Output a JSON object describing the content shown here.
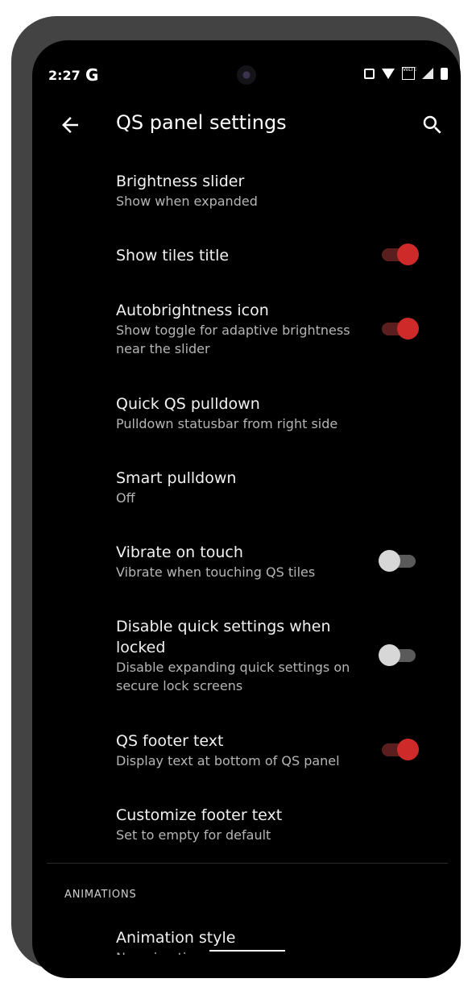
{
  "status_bar": {
    "time": "2:27",
    "carrier_glyph": "G",
    "icons": [
      "nfc-icon",
      "wifi-icon",
      "volte-icon",
      "signal-icon",
      "battery-icon"
    ],
    "volte_text": "VoLTE"
  },
  "app_bar": {
    "title": "QS panel settings",
    "back_icon": "arrow-left-icon",
    "search_icon": "search-icon"
  },
  "settings": [
    {
      "title": "Brightness slider",
      "subtitle": "Show when expanded"
    },
    {
      "title": "Show tiles title",
      "subtitle": "",
      "toggle": true
    },
    {
      "title": "Autobrightness icon",
      "subtitle": "Show toggle for adaptive brightness near the slider",
      "toggle": true
    },
    {
      "title": "Quick QS pulldown",
      "subtitle": "Pulldown statusbar from right side"
    },
    {
      "title": "Smart pulldown",
      "subtitle": "Off"
    },
    {
      "title": "Vibrate on touch",
      "subtitle": "Vibrate when touching QS tiles",
      "toggle": false
    },
    {
      "title": "Disable quick settings when locked",
      "subtitle": "Disable expanding quick settings on secure lock screens",
      "toggle": false
    },
    {
      "title": "QS footer text",
      "subtitle": "Display text at bottom of QS panel",
      "toggle": true
    },
    {
      "title": "Customize footer text",
      "subtitle": "Set to empty for default"
    }
  ],
  "section_header": "ANIMATIONS",
  "animation_item": {
    "title": "Animation style",
    "subtitle": "No animation"
  },
  "colors": {
    "accent": "#cf2a2a",
    "background": "#000000",
    "frame": "#434343"
  }
}
